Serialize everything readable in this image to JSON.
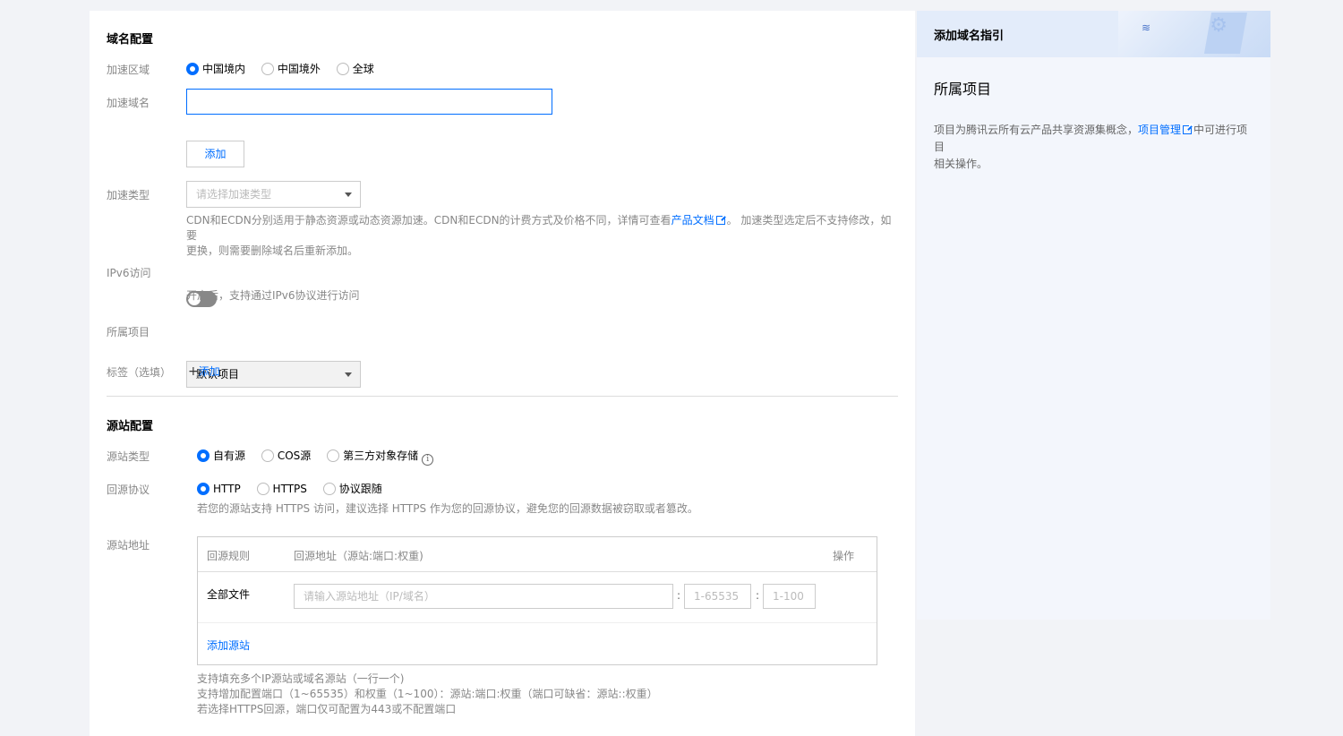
{
  "domain_config": {
    "title": "域名配置",
    "region_label": "加速区域",
    "region_options": [
      "中国境内",
      "中国境外",
      "全球"
    ],
    "domain_label": "加速域名",
    "domain_value": "",
    "add_button": "添加",
    "type_label": "加速类型",
    "type_placeholder": "请选择加速类型",
    "type_hint_1": "CDN和ECDN分别适用于静态资源或动态资源加速。CDN和ECDN的计费方式及价格不同，详情可查看",
    "type_hint_link": "产品文档",
    "type_hint_2": "。 加速类型选定后不支持修改，如要",
    "type_hint_3": "更换，则需要删除域名后重新添加。",
    "ipv6_label": "IPv6访问",
    "ipv6_hint": "开启后，支持通过IPv6协议进行访问",
    "project_label": "所属项目",
    "project_value": "默认项目",
    "tag_label": "标签（选填）",
    "tag_add": "添加"
  },
  "origin_config": {
    "title": "源站配置",
    "type_label": "源站类型",
    "type_options": [
      "自有源",
      "COS源",
      "第三方对象存储"
    ],
    "protocol_label": "回源协议",
    "protocol_options": [
      "HTTP",
      "HTTPS",
      "协议跟随"
    ],
    "protocol_hint": "若您的源站支持 HTTPS 访问，建议选择 HTTPS 作为您的回源协议，避免您的回源数据被窃取或者篡改。",
    "address_label": "源站地址",
    "table": {
      "col_rule": "回源规则",
      "col_address": "回源地址（源站:端口:权重)",
      "col_action": "操作",
      "row_rule": "全部文件",
      "address_placeholder": "请输入源站地址（IP/域名）",
      "port_placeholder": "1-65535",
      "weight_placeholder": "1-100",
      "sep": ":",
      "add_origin": "添加源站"
    },
    "notes": [
      "支持填充多个IP源站或域名源站（一行一个)",
      "支持增加配置端口（1~65535）和权重（1~100）：源站:端口:权重（端口可缺省：源站::权重）",
      "若选择HTTPS回源，端口仅可配置为443或不配置端口"
    ]
  },
  "guide": {
    "header": "添加域名指引",
    "title": "所属项目",
    "desc_1": "项目为腾讯云所有云产品共享资源集概念，",
    "desc_link": "项目管理",
    "desc_2": "中可进行项目",
    "desc_3": "相关操作。"
  },
  "colors": {
    "accent": "#006eff",
    "background": "#f2f3f7"
  }
}
